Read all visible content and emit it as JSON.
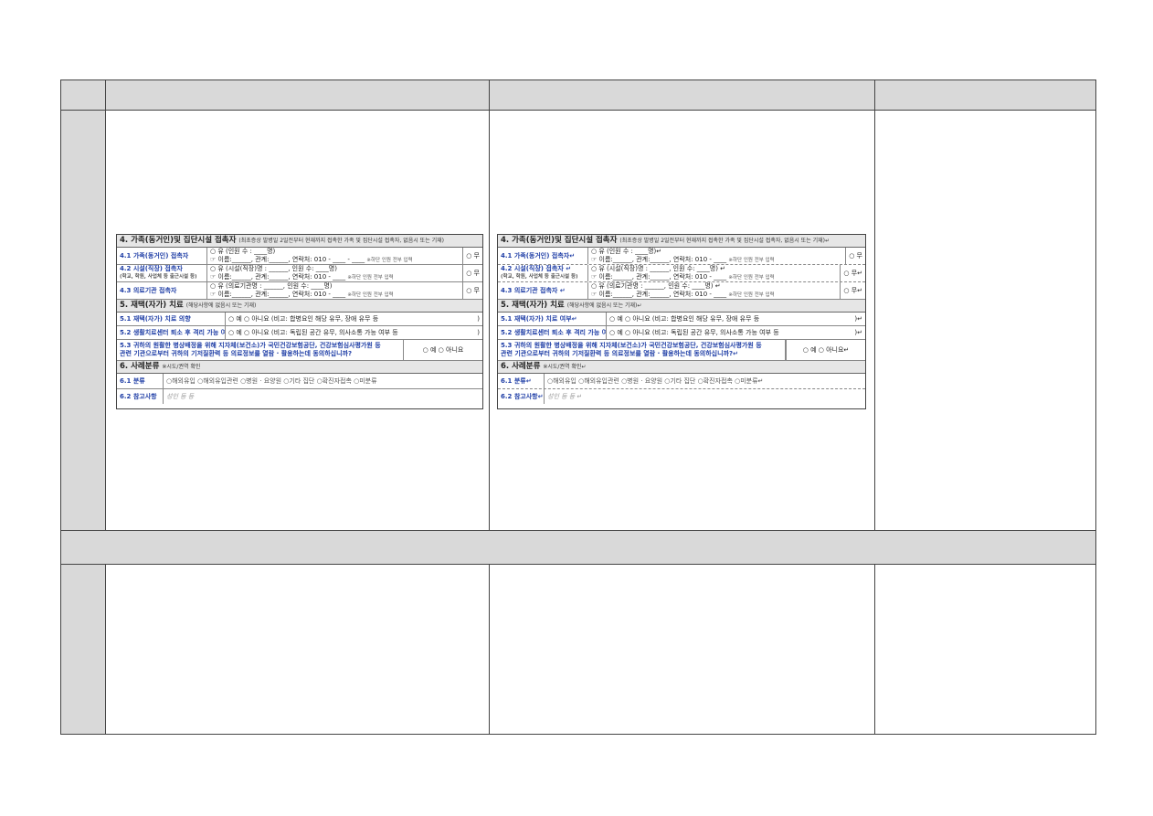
{
  "form_left": {
    "section4": {
      "title": "4. 가족(동거인)및 집단시설 접촉자",
      "note": "(최초증상 발병일 2일전부터 현재까지 접촉한 가족 및 집단시설 접촉자, 없음시 또는 기재)"
    },
    "row41": {
      "label": "4.1 가족(동거인) 접촉자",
      "line1": "○ 유 (인원 수 : ____명)",
      "line2": "☞ 이름:______, 관계:______, 연락처: 010 - ____ - ____",
      "hint": "※하단 인원 전부 입력",
      "option": "○ 무"
    },
    "row42": {
      "label": "4.2 시설(직장) 접촉자",
      "sub": "(학교, 학원, 사업체 등 출근시설 등)",
      "line1": "○ 유 (시설(직장)명 : ______, 인원 수: ____명)",
      "line2": "☞ 이름:______, 관계:______, 연락처: 010 - ____",
      "hint": "※하단 인원 전부 입력",
      "option": "○ 무"
    },
    "row43": {
      "label": "4.3 의료기관 접촉자",
      "line1": "○ 유 (의료기관명 : ______, 인원 수: ____명)",
      "line2": "☞ 이름:______, 관계:______, 연락처: 010 - ____",
      "hint": "※하단 인원 전부 입력",
      "option": "○ 무"
    },
    "section5": {
      "title": "5. 재택(자가) 치료",
      "note": "(해당사항에 없음시 또는 기재)"
    },
    "row51": {
      "label": "5.1 재택(자가) 치료 의향",
      "value": "○ 예   ○ 아니요 (비고: 합병요인 해당 유무, 장애 유무 등",
      "tail": ")"
    },
    "row52": {
      "label": "5.2 생활치료센터 퇴소 후 격리 가능 여부",
      "value": "○ 예   ○ 아니요 (비고: 독립된 공간 유무, 의사소통 가능 여부 등",
      "tail": ")"
    },
    "row53": {
      "text1": "5.3 귀하의 원활한 병상배정을 위해 지자체(보건소)가 국민건강보험공단, 건강보험심사평가원 등",
      "text2": "관련 기관으로부터 귀하의 기저질환력 등 의료정보를 열람 · 활용하는데 동의하십니까?",
      "option": "○ 예   ○ 아니요"
    },
    "section6": {
      "title": "6. 사례분류",
      "note": "※시도/권역 확인"
    },
    "row61": {
      "label": "6.1 분류",
      "options": "○해외유입   ○해외유입관련   ○병원 · 요양원   ○기타 집단   ○확진자접촉   ○미분류"
    },
    "row62": {
      "label": "6.2 참고사항",
      "value": "성인 등 등"
    }
  },
  "form_right": {
    "section4": {
      "title": "4. 가족(동거인)및 집단시설 접촉자",
      "note": "(최초증상 발병일 2일전부터 현재까지 접촉한 가족 및 집단시설 접촉자, 없음시 또는 기재)↵"
    },
    "row41": {
      "label": "4.1 가족(동거인) 접촉자↵",
      "line1": "○ 유 (인원 수 : ____명)↵",
      "line2": "☞ 이름:______, 관계:______, 연락처: 010 - ____",
      "hint": "※하단 인원 전부 입력",
      "option": "○ 무"
    },
    "row42": {
      "label": "4.2 시설(직장) 접촉자 ↵",
      "sub": "(학교, 학원, 사업체 등 출근시설 등)",
      "line1": "○ 유 (시설(직장)명 : ______, 인원 수: ____명) ↵",
      "line2": "☞ 이름:______, 관계:______, 연락처: 010 - ____",
      "hint": "※하단 인원 전부 입력",
      "option": "○ 무↵"
    },
    "row43": {
      "label": "4.3 의료기관 접촉자 ↵",
      "line1": "○ 유 (의료기관명 : ______, 인원 수: ____명) ↵",
      "line2": "☞ 이름:______, 관계:______, 연락처: 010 - ____",
      "hint": "※하단 인원 전부 입력",
      "option": "○ 무↵"
    },
    "section5": {
      "title": "5. 재택(자가) 치료",
      "note": "(해당사항에 없음시 또는 기재)↵"
    },
    "row51": {
      "label": "5.1 재택(자가) 치료 여부↵",
      "value": "○ 예   ○ 아니요 (비고: 합병요인 해당 유무, 장애 유무 등",
      "tail": ")↵"
    },
    "row52": {
      "label": "5.2 생활치료센터 퇴소 후 격리 가능 여부↵",
      "value": "○ 예   ○ 아니요 (비고: 독립된 공간 유무, 의사소통 가능 여부 등",
      "tail": ")↵"
    },
    "row53": {
      "text1": "5.3 귀하의 원활한 병상배정을 위해 지자체(보건소)가 국민건강보험공단, 건강보험심사평가원 등",
      "text2": "관련 기관으로부터 귀하의 기저질환력 등 의료정보를 열람 · 활용하는데 동의하십니까?↵",
      "option": "○ 예   ○ 아니요↵"
    },
    "section6": {
      "title": "6. 사례분류",
      "note": "※시도/권역 확인↵"
    },
    "row61": {
      "label": "6.1 분류↵",
      "options": "○해외유입   ○해외유입관련   ○병원 · 요양원   ○기타 집단   ○확진자접촉   ○미분류↵"
    },
    "row62": {
      "label": "6.2 참고사항↵",
      "value": "성인 등 등 ↵"
    }
  }
}
